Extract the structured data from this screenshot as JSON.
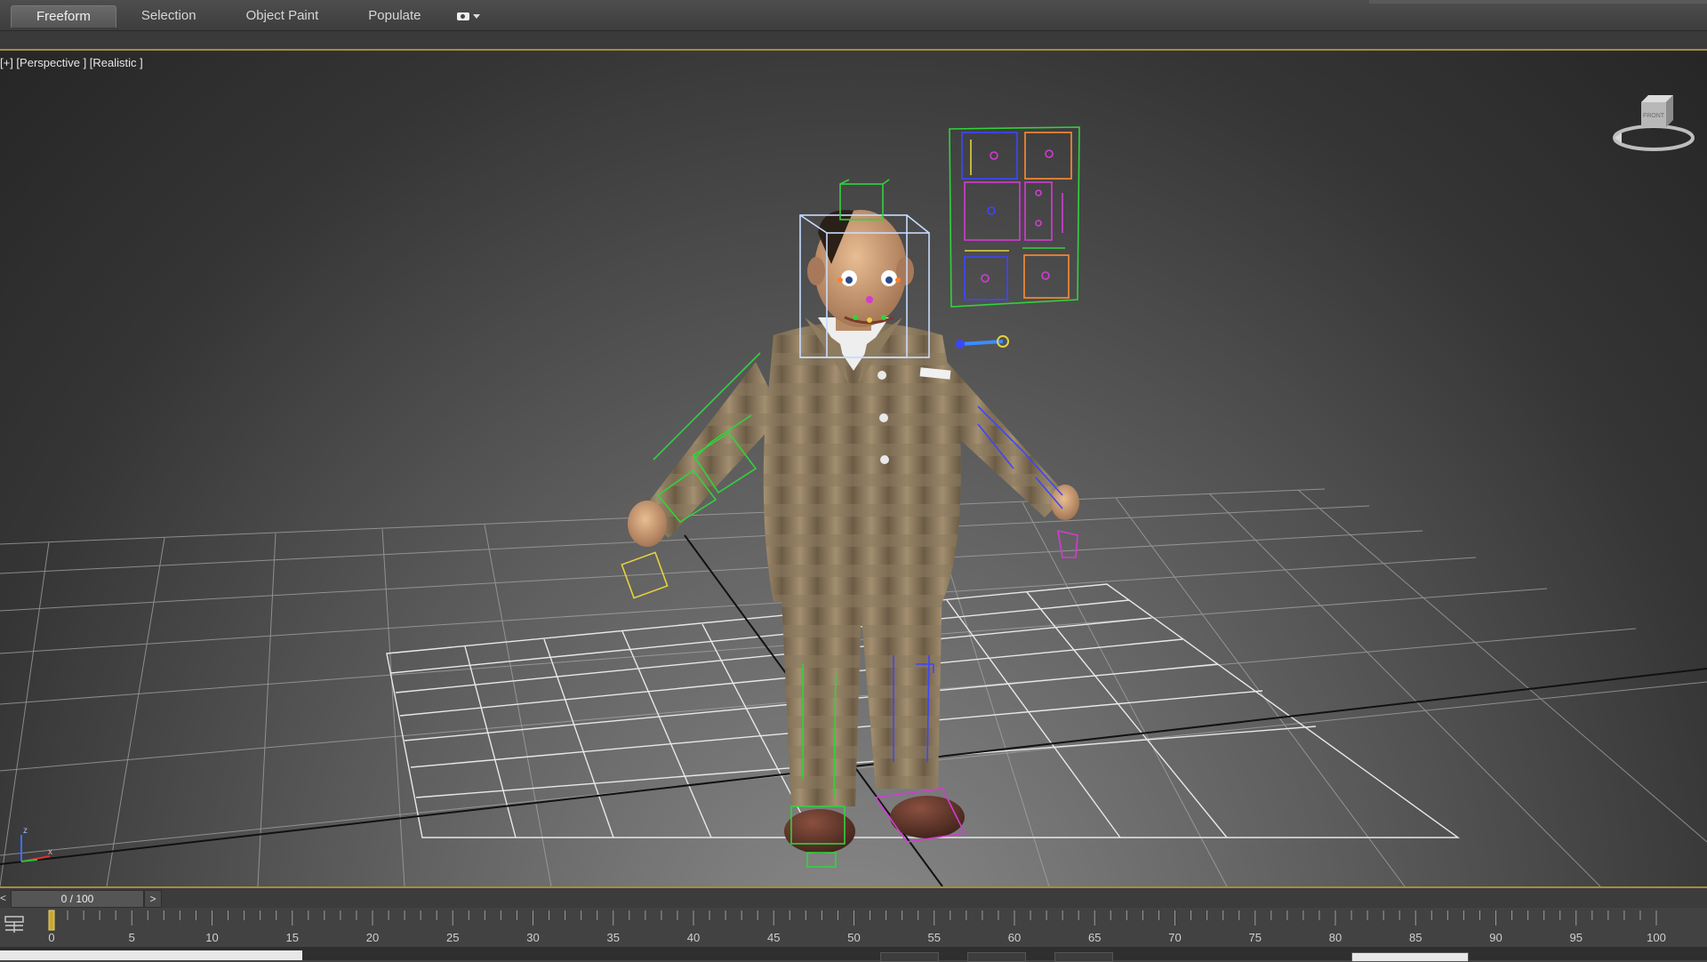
{
  "ribbon": {
    "tabs": [
      {
        "label": "Freeform",
        "active": true
      },
      {
        "label": "Selection",
        "active": false
      },
      {
        "label": "Object Paint",
        "active": false
      },
      {
        "label": "Populate",
        "active": false
      }
    ]
  },
  "viewport": {
    "label": "[+] [Perspective ] [Realistic ]",
    "viewcube_face": "FRONT",
    "axis_labels": {
      "z": "z",
      "x": "x"
    }
  },
  "timeline": {
    "prev_label": "<",
    "slider_value": "0 / 100",
    "next_label": ">",
    "ruler_labels": [
      "0",
      "5",
      "10",
      "15",
      "20",
      "25",
      "30",
      "35",
      "40",
      "45",
      "50",
      "55",
      "60",
      "65",
      "70",
      "75",
      "80",
      "85",
      "90",
      "95",
      "100"
    ]
  },
  "colors": {
    "accent": "#a88a3a",
    "panel": "#3c3c3c",
    "viewport_bg": "#3a3a3a",
    "rig_green": "#32d23c",
    "rig_blue": "#3c46ff",
    "rig_magenta": "#d23cd2",
    "rig_yellow": "#e6d23c",
    "rig_orange": "#ff8c32",
    "bbox_cyan": "#c8dcff"
  }
}
